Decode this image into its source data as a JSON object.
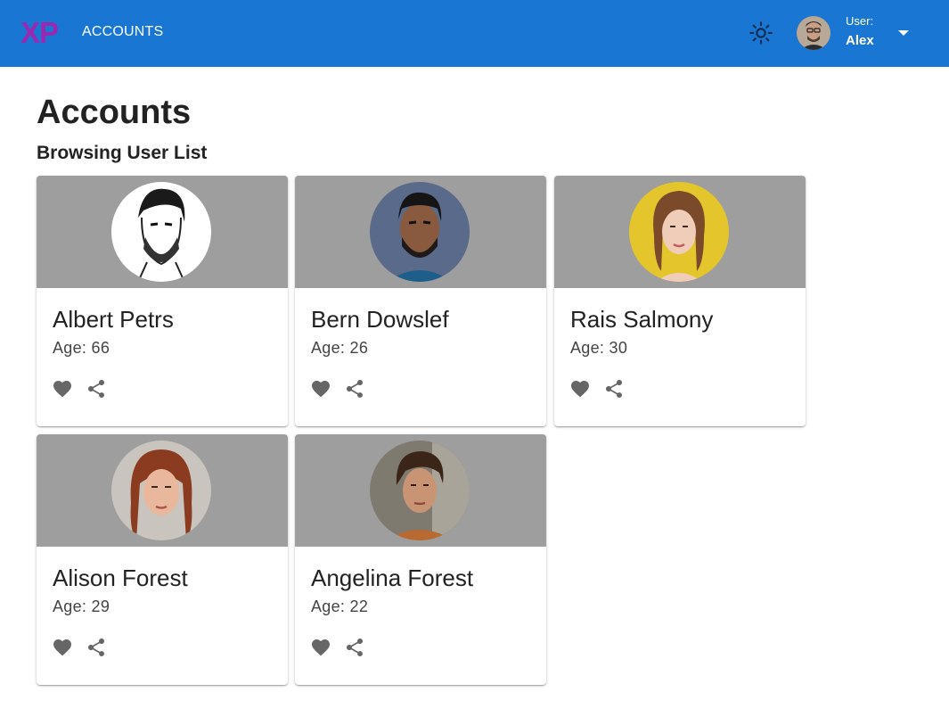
{
  "header": {
    "logo_text": "XP",
    "nav_link": "ACCOUNTS",
    "theme_toggle_icon": "sun-icon",
    "user_caption": "User:",
    "user_name": "Alex",
    "menu_icon": "caret-down-icon"
  },
  "main": {
    "title": "Accounts",
    "subtitle": "Browsing User List",
    "cards": [
      {
        "name": "Albert Petrs",
        "age": "Age: 66",
        "photo": "sketch-portrait-man"
      },
      {
        "name": "Bern Dowslef",
        "age": "Age: 26",
        "photo": "portrait-man-beard"
      },
      {
        "name": "Rais Salmony",
        "age": "Age: 30",
        "photo": "portrait-woman-yellow"
      },
      {
        "name": "Alison Forest",
        "age": "Age: 29",
        "photo": "portrait-woman-redhead"
      },
      {
        "name": "Angelina Forest",
        "age": "Age: 22",
        "photo": "portrait-woman-short-hair"
      }
    ],
    "card_actions": {
      "like_icon": "heart-icon",
      "share_icon": "share-icon"
    }
  },
  "colors": {
    "appbar": "#1976d2",
    "logo": "#9c27b0",
    "card_media": "#9e9e9e",
    "icon_gray": "#666666"
  }
}
